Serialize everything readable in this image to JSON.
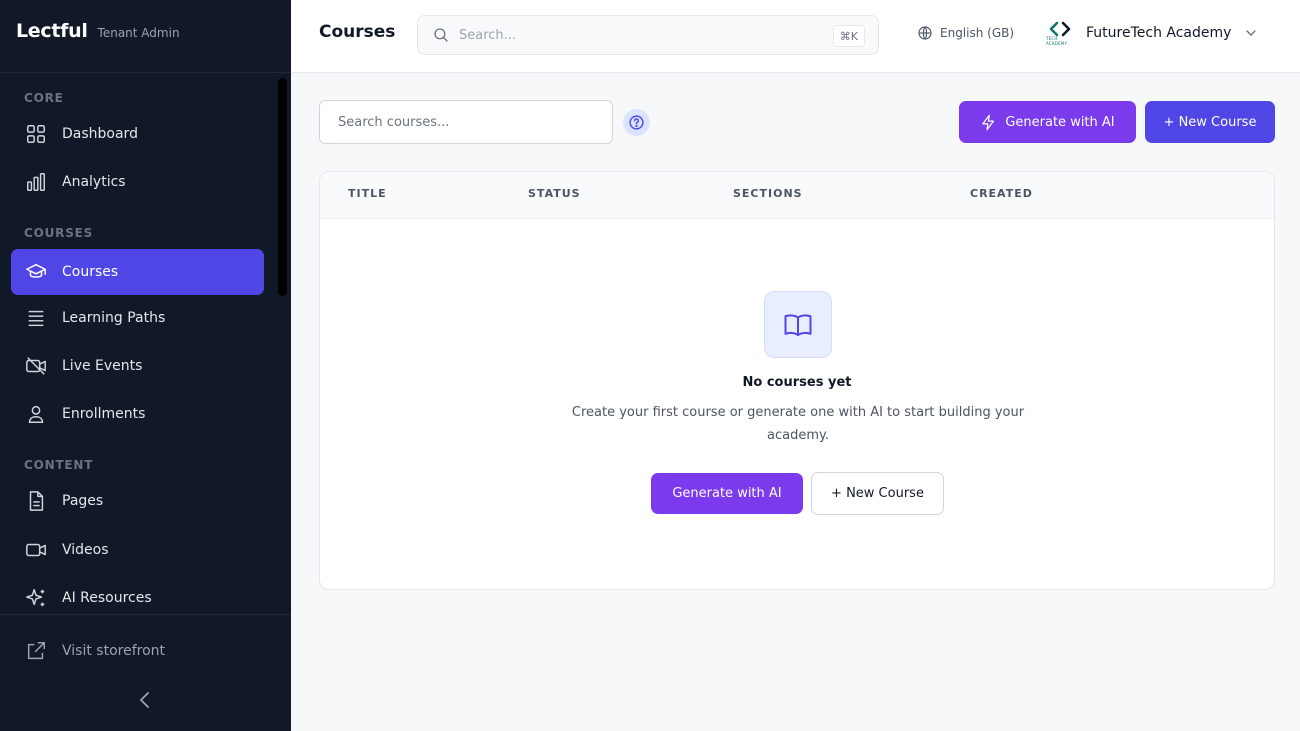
{
  "brand": {
    "name": "Lectful",
    "subtitle": "Tenant Admin"
  },
  "sidebar": {
    "sections": [
      {
        "label": "CORE"
      },
      {
        "label": "COURSES"
      },
      {
        "label": "CONTENT"
      }
    ],
    "items": [
      {
        "label": "Dashboard",
        "icon": "grid-icon"
      },
      {
        "label": "Analytics",
        "icon": "bar-chart-icon"
      },
      {
        "label": "Courses",
        "icon": "graduation-cap-icon",
        "active": true
      },
      {
        "label": "Learning Paths",
        "icon": "layers-icon"
      },
      {
        "label": "Live Events",
        "icon": "video-off-icon"
      },
      {
        "label": "Enrollments",
        "icon": "user-icon"
      },
      {
        "label": "Pages",
        "icon": "file-icon"
      },
      {
        "label": "Videos",
        "icon": "video-icon"
      },
      {
        "label": "AI Resources",
        "icon": "sparkles-icon"
      }
    ],
    "footer": {
      "visit_label": "Visit storefront"
    }
  },
  "header": {
    "title": "Courses",
    "search_placeholder": "Search...",
    "shortcut": "⌘K",
    "language": "English (GB)",
    "tenant_name": "FutureTech Academy",
    "tenant_logo_text": "TECH ACADEMY"
  },
  "main": {
    "course_search_placeholder": "Search courses...",
    "generate_label": "Generate with AI",
    "new_course_label": "+ New Course",
    "table": {
      "columns": [
        "TITLE",
        "STATUS",
        "SECTIONS",
        "CREATED"
      ]
    },
    "empty": {
      "title": "No courses yet",
      "description": "Create your first course or generate one with AI to start building your academy.",
      "generate_label": "Generate with AI",
      "new_course_label": "+ New Course"
    }
  },
  "colors": {
    "sidebar_bg": "#111827",
    "accent_indigo": "#4f46e5",
    "accent_purple": "#7c3aed"
  }
}
